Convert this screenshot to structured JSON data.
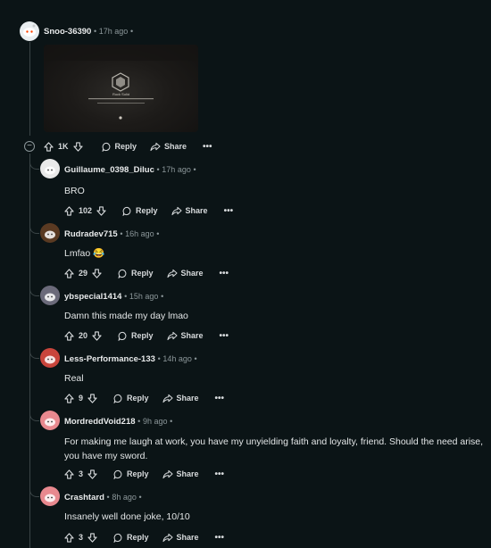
{
  "post": {
    "user": "Snoo-36390",
    "time": "17h ago",
    "upvotes": "1K",
    "reply_label": "Reply",
    "share_label": "Share",
    "more_label": "•••",
    "image_text": "Rock Solid"
  },
  "comments": [
    {
      "user": "Guillaume_0398_Diluc",
      "time": "17h ago",
      "text": "BRO",
      "votes": "102",
      "avatar_color": "#e9e9e9"
    },
    {
      "user": "Rudradev715",
      "time": "16h ago",
      "text": "Lmfao 😂",
      "votes": "29",
      "avatar_color": "#5a3a22"
    },
    {
      "user": "ybspecial1414",
      "time": "15h ago",
      "text": "Damn this made my day lmao",
      "votes": "20",
      "avatar_color": "#6b6a7a"
    },
    {
      "user": "Less-Performance-133",
      "time": "14h ago",
      "text": "Real",
      "votes": "9",
      "avatar_color": "#c9453c"
    },
    {
      "user": "MordreddVoid218",
      "time": "9h ago",
      "text": "For making me laugh at work, you have my unyielding faith and loyalty, friend. Should the need arise, you have my sword.",
      "votes": "3",
      "avatar_color": "#e8898f"
    },
    {
      "user": "Crashtard",
      "time": "8h ago",
      "text": "Insanely well done joke, 10/10",
      "votes": "3",
      "avatar_color": "#e8898f"
    }
  ],
  "labels": {
    "reply": "Reply",
    "share": "Share",
    "more": "•••",
    "sep": "•"
  }
}
